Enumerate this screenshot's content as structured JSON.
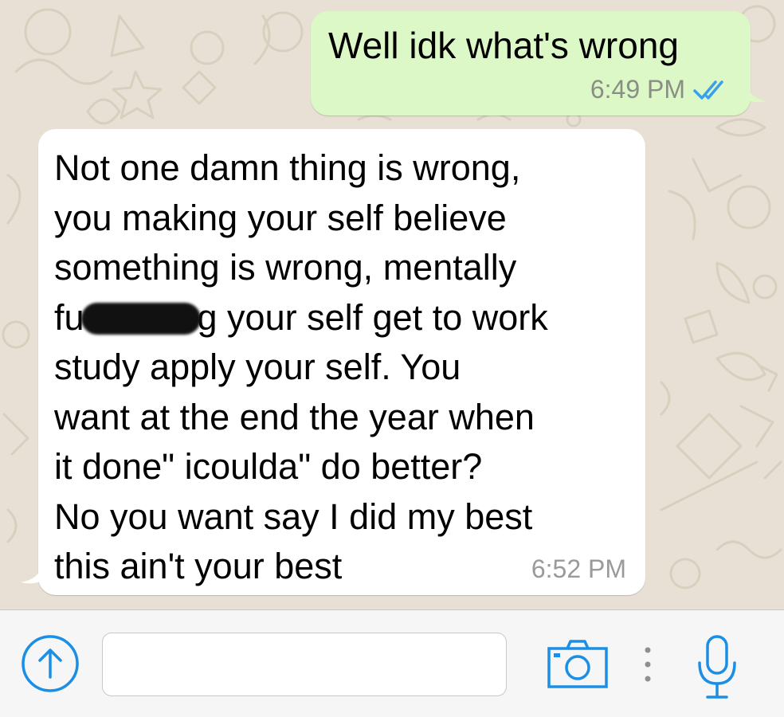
{
  "conversation": {
    "outgoing": {
      "text": "Well idk what's wrong",
      "time": "6:49 PM",
      "status_icon": "double-check-read-icon"
    },
    "incoming": {
      "lines": [
        "Not one damn thing is wrong,",
        "you making your self believe",
        "something is wrong, mentally",
        "g your self get to work",
        "study apply your self. You",
        "want at the end the year when",
        "it done\" icoulda\" do better?",
        "No you want say I did my best",
        "this ain't your best"
      ],
      "redacted_prefix": "fu",
      "time": "6:52 PM"
    }
  },
  "input_bar": {
    "message_value": "",
    "icons": [
      "upload-arrow-icon",
      "camera-icon",
      "more-dots-icon",
      "microphone-icon"
    ]
  },
  "colors": {
    "accent": "#1b8fe5",
    "outgoing_bubble": "#dcf8c6",
    "incoming_bubble": "#ffffff",
    "wallpaper": "#e8e0d4"
  }
}
